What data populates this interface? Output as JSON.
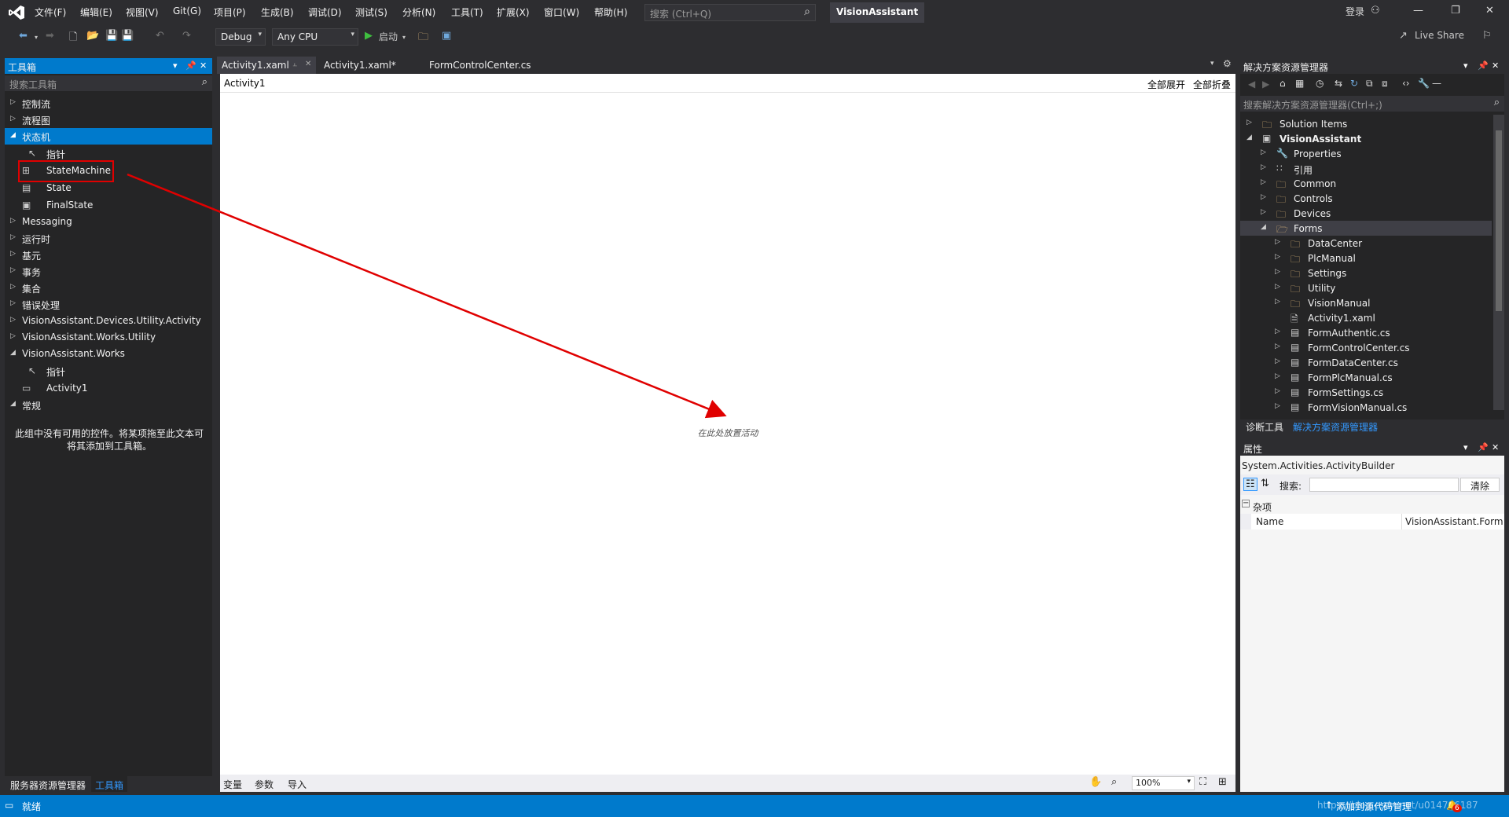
{
  "titlebar": {
    "menu": [
      "文件(F)",
      "编辑(E)",
      "视图(V)",
      "Git(G)",
      "项目(P)",
      "生成(B)",
      "调试(D)",
      "测试(S)",
      "分析(N)",
      "工具(T)",
      "扩展(X)",
      "窗口(W)",
      "帮助(H)"
    ],
    "search_placeholder": "搜索 (Ctrl+Q)",
    "solution_name": "VisionAssistant",
    "login": "登录"
  },
  "toolbar": {
    "config": "Debug",
    "platform": "Any CPU",
    "start": "启动",
    "live_share": "Live Share"
  },
  "toolbox": {
    "title": "工具箱",
    "search_placeholder": "搜索工具箱",
    "items": [
      {
        "label": "控制流",
        "expanded": false
      },
      {
        "label": "流程图",
        "expanded": false
      },
      {
        "label": "状态机",
        "expanded": true,
        "selected": true
      },
      {
        "child": "指针",
        "icon": "pointer"
      },
      {
        "child": "StateMachine",
        "icon": "statemachine"
      },
      {
        "child": "State",
        "icon": "state"
      },
      {
        "child": "FinalState",
        "icon": "finalstate"
      },
      {
        "label": "Messaging",
        "expanded": false
      },
      {
        "label": "运行时",
        "expanded": false
      },
      {
        "label": "基元",
        "expanded": false
      },
      {
        "label": "事务",
        "expanded": false
      },
      {
        "label": "集合",
        "expanded": false
      },
      {
        "label": "错误处理",
        "expanded": false
      },
      {
        "label": "VisionAssistant.Devices.Utility.Activity",
        "expanded": false
      },
      {
        "label": "VisionAssistant.Works.Utility",
        "expanded": false
      },
      {
        "label": "VisionAssistant.Works",
        "expanded": true
      },
      {
        "child": "指针",
        "icon": "pointer"
      },
      {
        "child": "Activity1",
        "icon": "activity"
      },
      {
        "label": "常规",
        "expanded": true
      }
    ],
    "empty_text_1": "此组中没有可用的控件。将某项拖至此文本可",
    "empty_text_2": "将其添加到工具箱。",
    "bottom_tabs": [
      "服务器资源管理器",
      "工具箱"
    ]
  },
  "doc_tabs": [
    "Activity1.xaml",
    "Activity1.xaml*",
    "FormControlCenter.cs"
  ],
  "designer": {
    "breadcrumb": "Activity1",
    "expand_all": "全部展开",
    "collapse_all": "全部折叠",
    "drop_hint": "在此处放置活动",
    "footer": [
      "变量",
      "参数",
      "导入"
    ],
    "zoom": "100%"
  },
  "solution_explorer": {
    "title": "解决方案资源管理器",
    "search_placeholder": "搜索解决方案资源管理器(Ctrl+;)",
    "tree": [
      {
        "label": "Solution Items",
        "indent": 0,
        "icon": "folder",
        "arrow": "right"
      },
      {
        "label": "VisionAssistant",
        "indent": 0,
        "icon": "project",
        "arrow": "down",
        "bold": true
      },
      {
        "label": "Properties",
        "indent": 1,
        "icon": "wrench",
        "arrow": "right"
      },
      {
        "label": "引用",
        "indent": 1,
        "icon": "reference",
        "arrow": "right"
      },
      {
        "label": "Common",
        "indent": 1,
        "icon": "folder",
        "arrow": "right"
      },
      {
        "label": "Controls",
        "indent": 1,
        "icon": "folder",
        "arrow": "right"
      },
      {
        "label": "Devices",
        "indent": 1,
        "icon": "folder",
        "arrow": "right"
      },
      {
        "label": "Forms",
        "indent": 1,
        "icon": "folder-open",
        "arrow": "down",
        "highlight": true
      },
      {
        "label": "DataCenter",
        "indent": 2,
        "icon": "folder",
        "arrow": "right"
      },
      {
        "label": "PlcManual",
        "indent": 2,
        "icon": "folder",
        "arrow": "right"
      },
      {
        "label": "Settings",
        "indent": 2,
        "icon": "folder",
        "arrow": "right"
      },
      {
        "label": "Utility",
        "indent": 2,
        "icon": "folder",
        "arrow": "right"
      },
      {
        "label": "VisionManual",
        "indent": 2,
        "icon": "folder",
        "arrow": "right"
      },
      {
        "label": "Activity1.xaml",
        "indent": 2,
        "icon": "xaml",
        "arrow": "none"
      },
      {
        "label": "FormAuthentic.cs",
        "indent": 2,
        "icon": "form",
        "arrow": "right"
      },
      {
        "label": "FormControlCenter.cs",
        "indent": 2,
        "icon": "form",
        "arrow": "right"
      },
      {
        "label": "FormDataCenter.cs",
        "indent": 2,
        "icon": "form",
        "arrow": "right"
      },
      {
        "label": "FormPlcManual.cs",
        "indent": 2,
        "icon": "form",
        "arrow": "right"
      },
      {
        "label": "FormSettings.cs",
        "indent": 2,
        "icon": "form",
        "arrow": "right"
      },
      {
        "label": "FormVisionManual.cs",
        "indent": 2,
        "icon": "form",
        "arrow": "right"
      }
    ],
    "bottom_tabs": [
      "诊断工具",
      "解决方案资源管理器"
    ]
  },
  "properties": {
    "title": "属性",
    "type": "System.Activities.ActivityBuilder",
    "search_label": "搜索:",
    "clear": "清除",
    "category": "杂项",
    "rows": [
      {
        "name": "Name",
        "value": "VisionAssistant.Forms"
      }
    ]
  },
  "statusbar": {
    "status": "就绪",
    "add_to_source": "添加到源代码管理",
    "watermark": "https://blog.csdn.net/u014786187",
    "notifications": "6"
  },
  "colors": {
    "accent": "#007acc",
    "annotation": "#e00000"
  }
}
